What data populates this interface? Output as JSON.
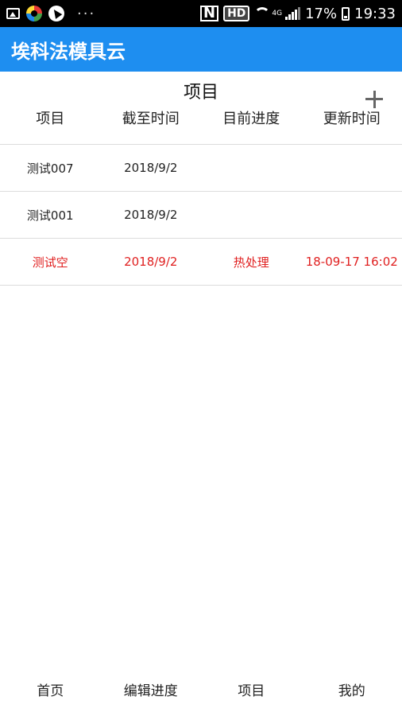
{
  "status_bar": {
    "battery": "17%",
    "time": "19:33",
    "hd": "HD",
    "network": "4G",
    "dots": "···"
  },
  "app": {
    "title": "埃科法模具云"
  },
  "page": {
    "title": "项目",
    "add_icon": "plus-icon"
  },
  "table": {
    "headers": [
      "项目",
      "截至时间",
      "目前进度",
      "更新时间"
    ],
    "rows": [
      {
        "project": "测试007",
        "deadline": "2018/9/2",
        "progress": "",
        "updated": ""
      },
      {
        "project": "测试001",
        "deadline": "2018/9/2",
        "progress": "",
        "updated": ""
      },
      {
        "project": "测试空",
        "deadline": "2018/9/2",
        "progress": "热处理",
        "updated": "18-09-17 16:02"
      }
    ],
    "highlight_color": "#e02020"
  },
  "bottom_nav": {
    "items": [
      "首页",
      "编辑进度",
      "项目",
      "我的"
    ]
  },
  "colors": {
    "app_bar": "#1e8ef0",
    "status_bar": "#000000"
  }
}
